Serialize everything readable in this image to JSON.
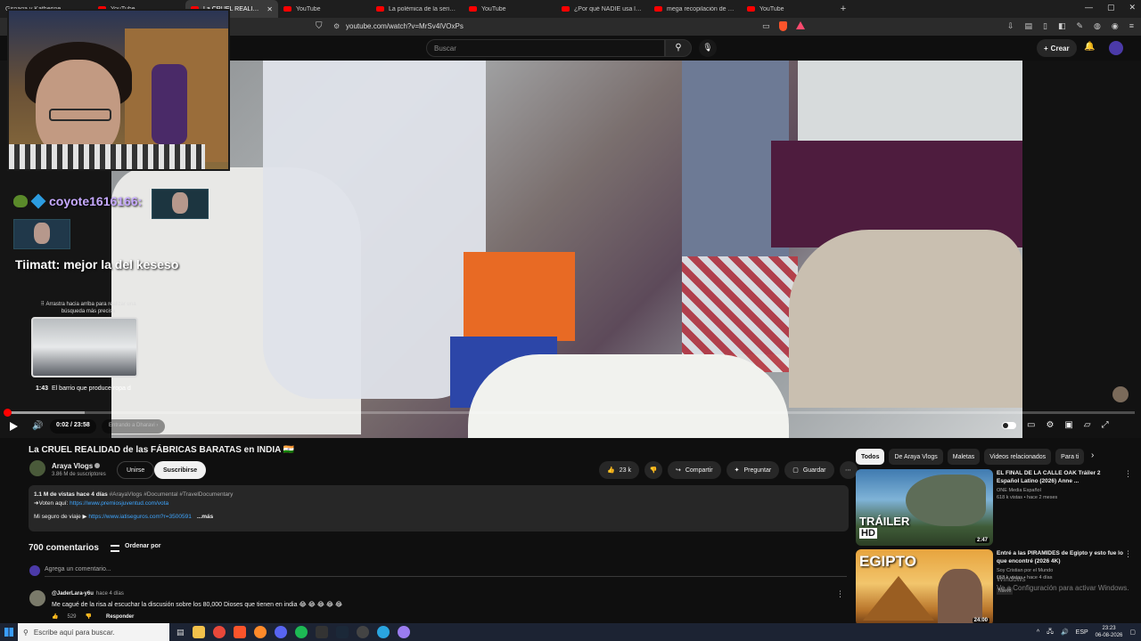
{
  "browser": {
    "tabs": [
      {
        "label": "Giroaga y Katherine",
        "active": false
      },
      {
        "label": "YouTube",
        "active": false
      },
      {
        "label": "La CRUEL REALIDAD de las",
        "active": true
      },
      {
        "label": "YouTube",
        "active": false
      },
      {
        "label": "La polémica de la serie IA de",
        "active": false
      },
      {
        "label": "YouTube",
        "active": false
      },
      {
        "label": "¿Por qué NADIE usa los CONG",
        "active": false
      },
      {
        "label": "mega recopilación de captura",
        "active": false
      },
      {
        "label": "YouTube",
        "active": false
      }
    ],
    "url": "youtube.com/watch?v=MrSv4lVOxPs"
  },
  "masthead": {
    "search_placeholder": "Buscar",
    "create_label": "Crear"
  },
  "overlay": {
    "chat_username": "coyote1616166:",
    "chat_message": "Tiimatt: mejor la del keseso",
    "drag_hint": "⠿ Arrastra hacia arriba para realizar una búsqueda más precisa",
    "preview_time": "1:43",
    "preview_chapter": "El barrio que produce ropa d"
  },
  "player": {
    "current_time": "0:02",
    "duration": "23:58",
    "time_display": "0:02 / 23:58",
    "chapter_label": "Entrando a Dharavi ›",
    "progress_fraction": 0.002
  },
  "video": {
    "title": "La CRUEL REALIDAD de las FÁBRICAS BARATAS en INDIA 🇮🇳",
    "channel": "Araya Vlogs",
    "subscribers": "3.86 M de suscriptores",
    "join_label": "Unirse",
    "subscribe_label": "Suscribirse",
    "likes": "23 k",
    "share_label": "Compartir",
    "ask_label": "Preguntar",
    "save_label": "Guardar"
  },
  "description": {
    "views_date": "1.1 M de vistas  hace 4 días",
    "tags": "#ArayaVlogs #Documental #TravelDocumentary",
    "vote_text": "➜Voten aquí: ",
    "vote_link": "https://www.premiosjuventud.com/vota",
    "insurance_text": "Mi seguro de viaje ▶ ",
    "insurance_link": "https://www.iatiseguros.com?r=3500591",
    "more_label": "...más"
  },
  "comments": {
    "count_label": "700 comentarios",
    "sort_label": "Ordenar por",
    "add_placeholder": "Agrega un comentario...",
    "items": [
      {
        "author": "@JaderLara-y6u",
        "time": "hace 4 días",
        "text": "Me cagué de la risa al escuchar la discusión sobre los 80,000 Dioses  que tienen en india 😂 😂 😂 😂 😂",
        "likes": "529",
        "reply_label": "Responder"
      }
    ]
  },
  "sidebar": {
    "chips": [
      "Todos",
      "De Araya Vlogs",
      "Maletas",
      "Videos relacionados",
      "Para ti"
    ],
    "recommendations": [
      {
        "thumb_text": "TRÁILER",
        "thumb_badge": "HD",
        "duration": "2:47",
        "title": "EL FINAL DE LA CALLE OAK Tráiler 2 Español Latino (2026) Anne ...",
        "channel": "ONE Media Español",
        "meta": "618 k vistas • hace 2 meses",
        "badge": ""
      },
      {
        "thumb_text": "EGIPTO",
        "thumb_badge": "",
        "duration": "24:00",
        "title": "Entré a las PIRAMIDES de Egipto y esto fue lo que encontré (2026 4K)",
        "channel": "Soy Cristian por el Mundo",
        "meta": "153 k vistas • hace 4 días",
        "badge": "Nuevo"
      }
    ],
    "watermark_line1": "Windows",
    "watermark_line2": "Ve a Configuración para activar Windows."
  },
  "taskbar": {
    "search_placeholder": "Escribe aquí para buscar.",
    "lang": "ESP",
    "time": "23:23",
    "date": "06-08-2026"
  },
  "colors": {
    "accent_red": "#ff0000",
    "link_blue": "#3ea6ff",
    "chat_name": "#c6a9ff",
    "background": "#0f0f0f"
  }
}
